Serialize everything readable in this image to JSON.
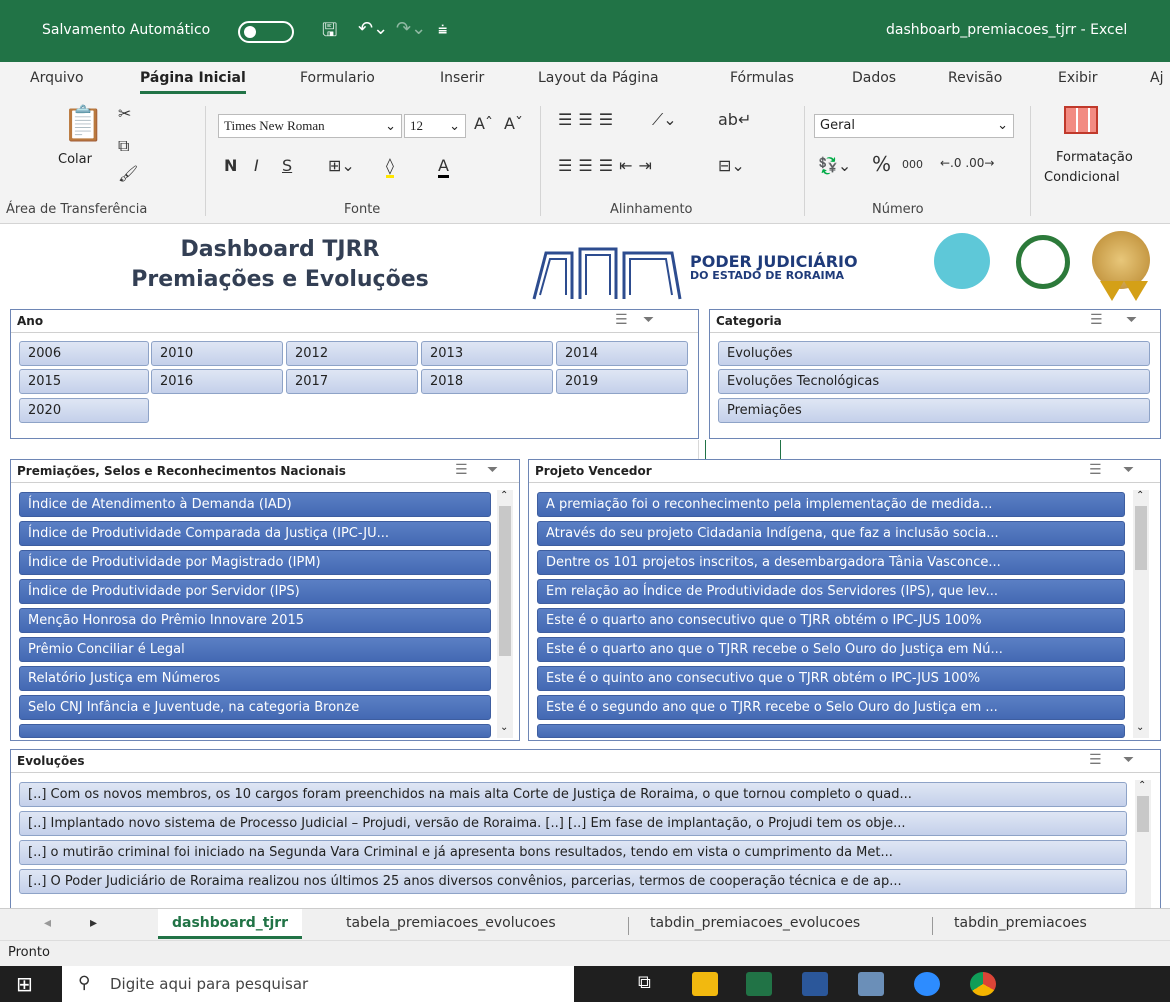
{
  "titlebar": {
    "autosave_label": "Salvamento Automático",
    "filename": "dashboarb_premiacoes_tjrr  -  Excel"
  },
  "ribbon_tabs": [
    "Arquivo",
    "Página Inicial",
    "Formulario",
    "Inserir",
    "Layout da Página",
    "Fórmulas",
    "Dados",
    "Revisão",
    "Exibir",
    "Aj"
  ],
  "ribbon": {
    "paste": "Colar",
    "font_name": "Times New Roman",
    "font_size": "12",
    "bold": "N",
    "italic": "I",
    "underline": "S",
    "number_format": "Geral",
    "cond_format_1": "Formatação",
    "cond_format_2": "Condicional",
    "groups": [
      "Área de Transferência",
      "Fonte",
      "Alinhamento",
      "Número"
    ]
  },
  "dashboard": {
    "title_line1": "Dashboard TJRR",
    "title_line2": "Premiações e Evoluções",
    "logo_text1": "PODER JUDICIÁRIO",
    "logo_text2": "DO ESTADO DE RORAIMA"
  },
  "slicer_ano": {
    "title": "Ano",
    "items": [
      "2006",
      "2010",
      "2012",
      "2013",
      "2014",
      "2015",
      "2016",
      "2017",
      "2018",
      "2019",
      "2020"
    ]
  },
  "slicer_categoria": {
    "title": "Categoria",
    "items": [
      "Evoluções",
      "Evoluções Tecnológicas",
      "Premiações"
    ]
  },
  "slicer_premiacoes": {
    "title": "Premiações, Selos e Reconhecimentos Nacionais",
    "items": [
      "Índice de Atendimento à Demanda (IAD)",
      "Índice de Produtividade Comparada da Justiça (IPC-JU...",
      "Índice de Produtividade por Magistrado (IPM)",
      "Índice de Produtividade por Servidor (IPS)",
      "Menção Honrosa do Prêmio Innovare 2015",
      "Prêmio Conciliar é Legal",
      "Relatório Justiça em Números",
      "Selo CNJ Infância e Juventude, na categoria Bronze"
    ]
  },
  "slicer_projeto": {
    "title": "Projeto Vencedor",
    "items": [
      "A premiação foi o reconhecimento pela implementação de medida...",
      "Através do seu projeto Cidadania Indígena, que faz a inclusão socia...",
      "Dentre os 101 projetos inscritos, a desembargadora Tânia Vasconce...",
      "Em relação ao Índice de Produtividade dos Servidores (IPS), que lev...",
      "Este é o quarto ano consecutivo que o TJRR obtém o IPC-JUS 100%",
      "Este é o quarto ano que o TJRR recebe o Selo Ouro do Justiça em Nú...",
      "Este é o quinto ano consecutivo que o TJRR obtém o IPC-JUS 100%",
      "Este é o segundo ano que o TJRR recebe o Selo Ouro do Justiça em ..."
    ]
  },
  "slicer_evolucoes": {
    "title": "Evoluções",
    "items": [
      "[..] Com os novos membros, os 10 cargos foram preenchidos na mais alta Corte de Justiça de Roraima, o que tornou completo o quad...",
      "[..] Implantado novo sistema de Processo Judicial – Projudi, versão de Roraima. [..] [..] Em fase de implantação, o Projudi tem os obje...",
      "[..] o mutirão criminal foi iniciado na Segunda Vara Criminal e já apresenta bons resultados, tendo em vista o cumprimento da Met...",
      "[..] O Poder Judiciário de Roraima realizou nos últimos 25 anos diversos convênios, parcerias, termos de cooperação técnica e de ap..."
    ]
  },
  "sheet_tabs": [
    "dashboard_tjrr",
    "tabela_premiacoes_evolucoes",
    "tabdin_premiacoes_evolucoes",
    "tabdin_premiacoes"
  ],
  "status": "Pronto",
  "taskbar": {
    "search_placeholder": "Digite aqui para pesquisar"
  },
  "colors": {
    "excel_green": "#217346",
    "slicer_selected": "#4a6fb8",
    "slicer_unselected": "#c9d5ee"
  }
}
